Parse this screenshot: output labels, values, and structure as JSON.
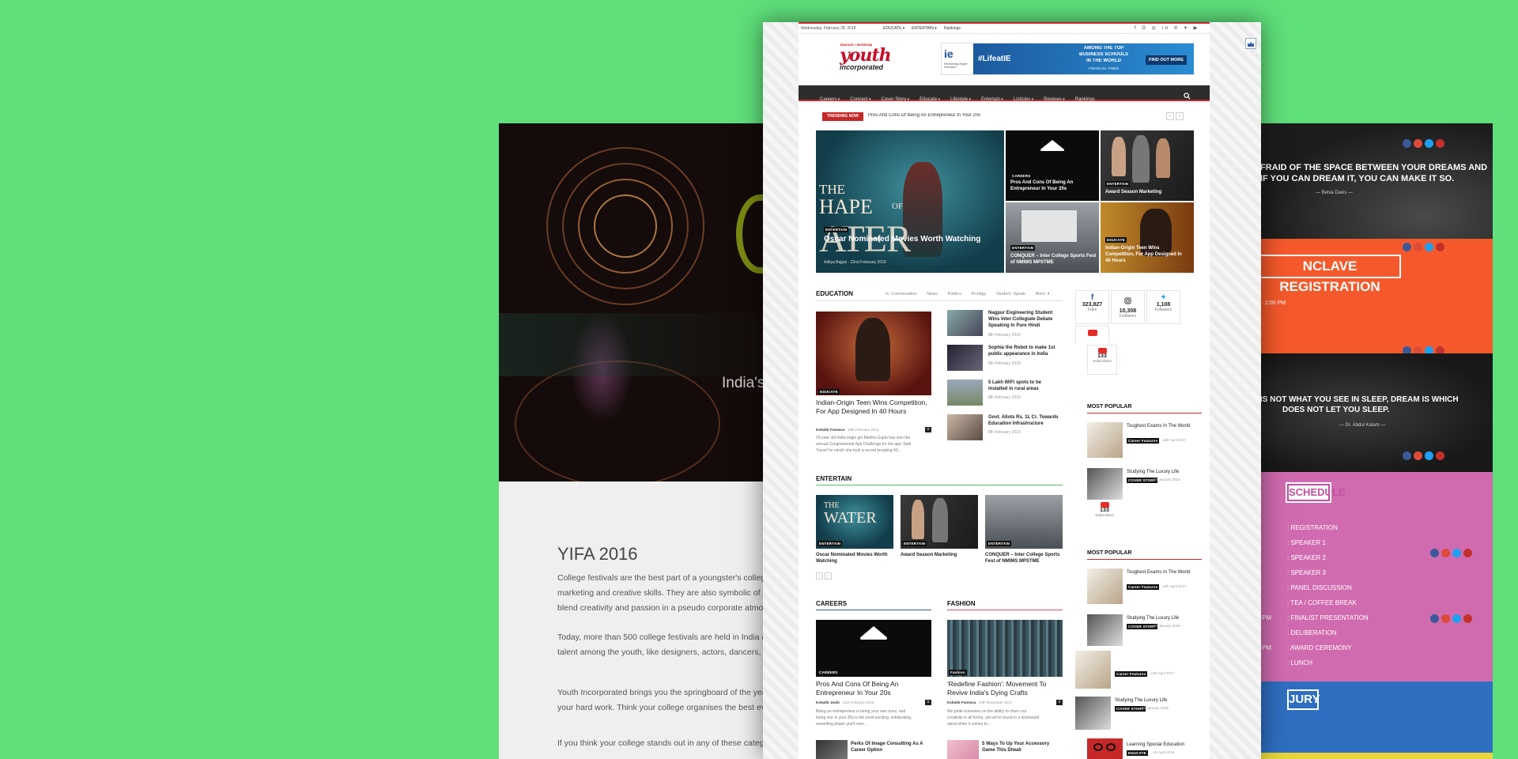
{
  "left": {
    "hero_text": "India's",
    "title": "YIFA 2016",
    "paragraphs": [
      "College festivals are the best part of a youngster's college e",
      "marketing and creative skills. They are also symbolic of stud",
      "blend creativity and passion in a pseudo corporate atmosp",
      "Today, more than 500 college festivals are held in India and",
      "talent among the youth, like designers, actors, dancers, sing",
      "Youth Incorporated brings you the springboard of the year",
      "your hard work. Think your college organises the best even",
      "If you think your college stands out in any of these categori"
    ]
  },
  "right": {
    "quote1": [
      "FRAID OF THE SPACE BETWEEN YOUR DREAMS AND",
      "IF YOU CAN DREAM IT, YOU CAN MAKE IT SO."
    ],
    "quote1_author": "— Belva Davis —",
    "registration": "NCLAVE REGISTRATION",
    "time_text": "2:00 PM",
    "quote2": [
      "IS NOT WHAT YOU SEE IN SLEEP, DREAM IS WHICH",
      "DOES NOT LET YOU SLEEP."
    ],
    "quote2_author": "— Dr. Abdul Kalam —",
    "schedule_title": "SCHEDULE",
    "schedule": [
      ": REGISTRATION",
      ": SPEAKER 1",
      ": SPEAKER 2",
      ": SPEAKER 3",
      ": PANEL DISCUSSION",
      ": TEA / COFFEE BREAK",
      ": FINALIST PRESENTATION",
      ": DELIBERATION",
      ": AWARD CEREMONY",
      ": LUNCH"
    ],
    "schedule_pm": [
      "PM",
      "PM"
    ],
    "jury": "JURY",
    "colors": {
      "dark": "#1f1f1f",
      "orange": "#f5592b",
      "pink": "#d16bb0",
      "blue": "#2f6fc1"
    }
  },
  "site": {
    "date": "Wednesday, February 28, 2018",
    "top_links": [
      "EDUCATE",
      "ENTERTAIN",
      "Rankings"
    ],
    "logo_tag": "EDUCATE + ENTERTAIN",
    "logo_1": "youth",
    "logo_2": "incorporated",
    "ad": {
      "ie": "ie",
      "ie_sub": "Reinventing Higher Education",
      "hashtag": "#LifeatIE",
      "text": [
        "AMONG THE TOP",
        "BUSINESS SCHOOLS",
        "IN THE WORLD"
      ],
      "source": "FINANCIAL TIMES",
      "cta": "FIND OUT MORE"
    },
    "nav": [
      "Careers",
      "Connect",
      "Cover Story",
      "Educate",
      "Lifestyle",
      "Entertain",
      "Listicles",
      "Reviews",
      "Rankings"
    ],
    "trending_label": "TRENDING NOW",
    "trending_text": "Pros And Cons Of Being An Entrepreneur In Your 20s",
    "feature": {
      "main": {
        "poster": [
          "THE",
          "HAPE",
          "OF",
          "ATER"
        ],
        "cat": "ENTERTAIN",
        "title": "Oscar Nominated Movies Worth Watching",
        "meta": "Aditya Bajpai - 22nd February 2018"
      },
      "tiles": [
        {
          "cat": "CAREERS",
          "title": "Pros And Cons Of Being An Entrepreneur In Your 20s"
        },
        {
          "cat": "ENTERTAIN",
          "title": "Award Season Marketing"
        },
        {
          "cat": "ENTERTAIN",
          "title": "CONQUER – Inter College Sports Fest of NMIMS MPSTME"
        },
        {
          "cat": "EDUCATE",
          "title": "Indian-Origin Teen Wins Competition, For App Designed In 40 Hours"
        }
      ]
    },
    "education": {
      "title": "EDUCATION",
      "tabs": [
        "In Conversation",
        "News",
        "Politics",
        "Prodigy",
        "Student Speak",
        "More"
      ],
      "lead": {
        "cat": "EDUCATE",
        "title": "Indian-Origin Teen Wins Competition, For App Designed In 40 Hours",
        "author": "Kshullir Fonseca",
        "date": "19th February 2018",
        "comments": "0",
        "excerpt": [
          "15-year old India-origin girl Medha Gupta has won the",
          "annual Congressional App Challenge for her app 'Safe",
          "Travel' for which she took a record breaking 40..."
        ]
      },
      "items": [
        {
          "title": "Nagpur Engineering Student Wins Inter-Collegiate Debate Speaking In Pure Hindi",
          "date": "8th February 2018"
        },
        {
          "title": "Sophia the Robot to make 1st public appearance in India",
          "date": "8th February 2018"
        },
        {
          "title": "5 Lakh WiFi spots to be installed in rural areas",
          "date": "8th February 2018"
        },
        {
          "title": "Govt. Allots Rs. 1L Cr. Towards Education Infrastructure",
          "date": "8th February 2018"
        }
      ]
    },
    "social": [
      {
        "icon": "facebook-icon",
        "count": "323,827",
        "label": "Fans",
        "color": "#3b5998"
      },
      {
        "icon": "instagram-icon",
        "count": "10,308",
        "label": "Followers",
        "color": "#444444"
      },
      {
        "icon": "twitter-icon",
        "count": "1,108",
        "label": "Followers",
        "color": "#1da1f2"
      },
      {
        "icon": "youtube-icon",
        "count": "133",
        "label": "Subscribers",
        "color": "#e52d27"
      }
    ],
    "entertain": {
      "title": "ENTERTAIN",
      "items": [
        {
          "cat": "ENTERTAIN",
          "title": "Oscar Nominated Movies Worth Watching"
        },
        {
          "cat": "ENTERTAIN",
          "title": "Award Season Marketing"
        },
        {
          "cat": "ENTERTAIN",
          "title": "CONQUER – Inter College Sports Fest of NMIMS MPSTME"
        }
      ]
    },
    "most_popular_title": "MOST POPULAR",
    "most_popular": [
      {
        "title": "Toughest Exams In The World",
        "cat": "Career Features",
        "date": "12th April 2017"
      },
      {
        "title": "Studying The Luxury Life",
        "cat": "COVER STORY",
        "date": "7th January 2016"
      }
    ],
    "most_popular_2": [
      {
        "title": "Toughest Exams In The World",
        "cat": "Career Features",
        "date": "12th April 2017"
      },
      {
        "title": "Studying The Luxury Life",
        "cat": "COVER STORY",
        "date": "7th January 2016"
      }
    ],
    "most_popular_3": [
      {
        "title": "",
        "cat": "Career Features",
        "date": "12th April 2017"
      },
      {
        "title": "Studying The Luxury Life",
        "cat": "COVER STORY",
        "date": "7th January 2016"
      },
      {
        "title": "Learning Special Education",
        "cat": "EDUCATE",
        "date": "1st April 2016"
      }
    ],
    "careers": {
      "title": "CAREERS",
      "lead": {
        "cat": "CAREERS",
        "title": "Pros And Cons Of Being An Entrepreneur In Your 20s",
        "author": "Kshullir Joshi",
        "date": "21st February 2018",
        "comments": "0",
        "excerpt": [
          "Being an entrepreneur is being your own boss, and",
          "being one in your 20s is the most exciting, exhilarating,",
          "rewarding phase you'll ever..."
        ]
      },
      "item": {
        "title": "Perks Of Image Consulting As A Career Option"
      }
    },
    "fashion": {
      "title": "FASHION",
      "lead": {
        "cat": "Fashion",
        "title": "'Redefine Fashion': Movement To Revive India's Dying Crafts",
        "author": "Kshullir Fonseca",
        "date": "24th November 2017",
        "comments": "0",
        "excerpt": [
          "We pride ourselves on the ability to churn out",
          "creativity in all forms, yet we've found in a downward",
          "spiral when it comes to..."
        ]
      },
      "item": {
        "title": "5 Ways To Up Your Accessory Game This Diwali"
      }
    }
  }
}
